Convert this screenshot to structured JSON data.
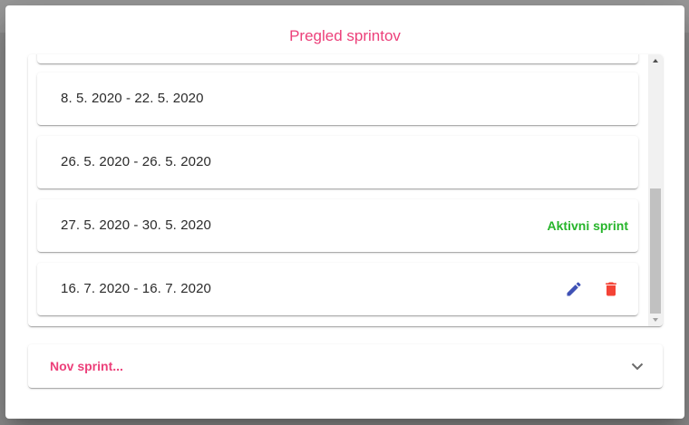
{
  "dialog": {
    "title": "Pregled sprintov"
  },
  "sprints": [
    {
      "range": ""
    },
    {
      "range": "8. 5. 2020 - 22. 5. 2020"
    },
    {
      "range": "26. 5. 2020 - 26. 5. 2020"
    },
    {
      "range": "27. 5. 2020 - 30. 5. 2020",
      "status": "Aktivni sprint"
    },
    {
      "range": "16. 7. 2020 - 16. 7. 2020",
      "actions": [
        "edit-icon",
        "delete-icon"
      ]
    }
  ],
  "new_sprint": {
    "label": "Nov sprint...",
    "icon": "chevron-down-icon"
  },
  "colors": {
    "title": "#ec407a",
    "active_status": "#27b52b",
    "edit_icon": "#3f51b5",
    "delete_icon": "#f44336"
  }
}
